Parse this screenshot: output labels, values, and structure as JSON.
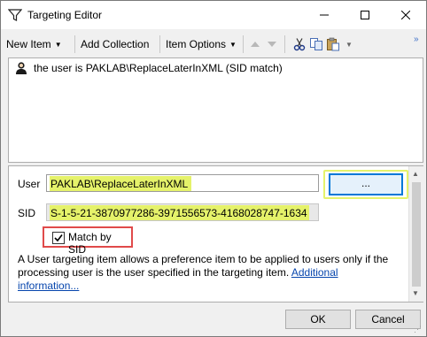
{
  "window": {
    "title": "Targeting Editor"
  },
  "toolbar": {
    "new_item": "New Item",
    "add_collection": "Add Collection",
    "item_options": "Item Options"
  },
  "list": {
    "items": [
      {
        "label": "the user is PAKLAB\\ReplaceLaterInXML (SID match)",
        "icon": "user-icon"
      }
    ]
  },
  "props": {
    "user_label": "User",
    "user_value": "PAKLAB\\ReplaceLaterInXML",
    "browse_label": "...",
    "sid_label": "SID",
    "sid_value": "S-1-5-21-3870977286-3971556573-4168028747-1634",
    "match_label": "Match by SID",
    "match_checked": true,
    "description": "A User targeting item allows a preference item to be applied to users only if the processing user is the user specified in the targeting item.",
    "link_text": "Additional information..."
  },
  "buttons": {
    "ok": "OK",
    "cancel": "Cancel"
  },
  "colors": {
    "highlight": "#e5f26a",
    "callout": "#e04a4a",
    "link": "#0645ad"
  }
}
